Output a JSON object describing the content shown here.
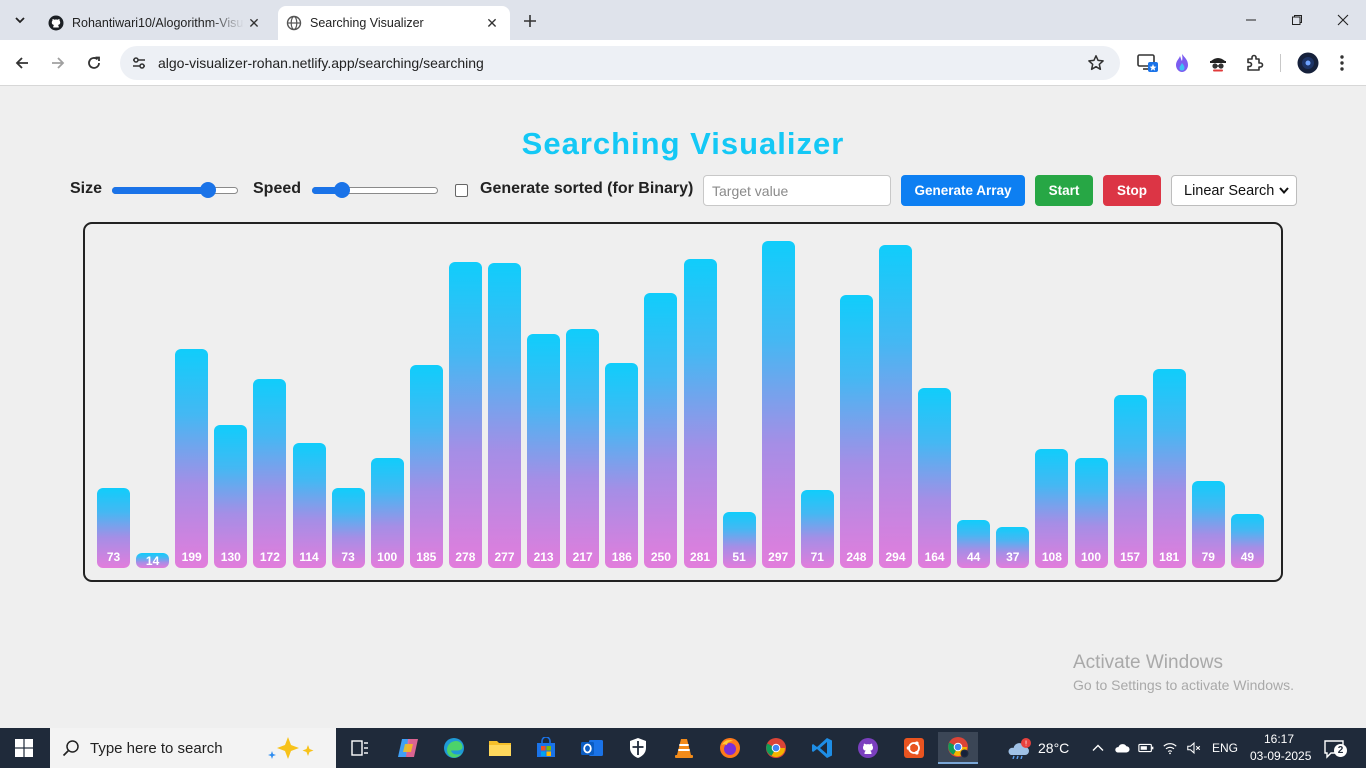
{
  "browser": {
    "tabs": [
      {
        "title": "Rohantiwari10/Alogorithm-Visu",
        "icon": "github-icon",
        "active": false
      },
      {
        "title": "Searching Visualizer",
        "icon": "globe-icon",
        "active": true
      }
    ],
    "url": "algo-visualizer-rohan.netlify.app/searching/searching"
  },
  "page": {
    "title": "Searching Visualizer",
    "controls": {
      "size_label": "Size",
      "size_value": 0.8,
      "speed_label": "Speed",
      "speed_value": 0.2,
      "sorted_label": "Generate sorted (for Binary)",
      "sorted_checked": false,
      "target_placeholder": "Target value",
      "target_value": "",
      "generate_label": "Generate Array",
      "start_label": "Start",
      "stop_label": "Stop",
      "algorithm_selected": "Linear Search"
    },
    "array": [
      73,
      14,
      199,
      130,
      172,
      114,
      73,
      100,
      185,
      278,
      277,
      213,
      217,
      186,
      250,
      281,
      51,
      297,
      71,
      248,
      294,
      164,
      44,
      37,
      108,
      100,
      157,
      181,
      79,
      49
    ],
    "array_max": 300
  },
  "watermark": {
    "line1": "Activate Windows",
    "line2": "Go to Settings to activate Windows."
  },
  "taskbar": {
    "search_placeholder": "Type here to search",
    "weather": "28°C",
    "language": "ENG",
    "time": "16:17",
    "date": "03-09-2025",
    "notifications": "2"
  },
  "colors": {
    "title": "#14c8f5",
    "generate": "#0d7ff2",
    "start": "#27a745",
    "stop": "#dc3545",
    "bar_top": "#10cdfb",
    "bar_bottom": "#e27ddc"
  }
}
